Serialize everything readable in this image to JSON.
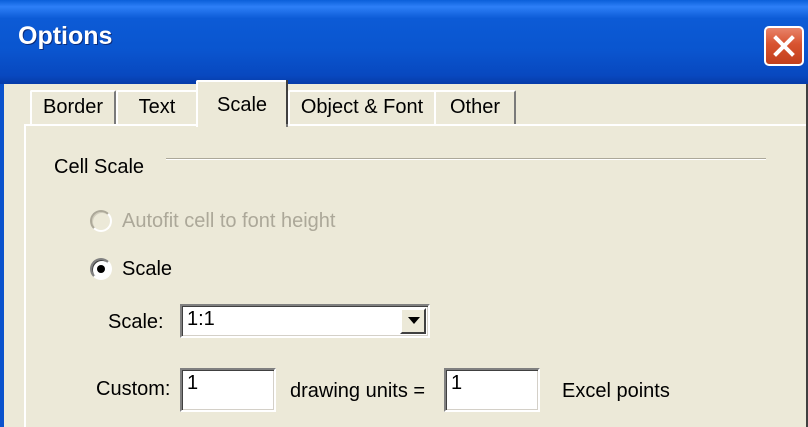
{
  "window": {
    "title": "Options"
  },
  "tabs": [
    {
      "label": "Border",
      "active": false
    },
    {
      "label": "Text",
      "active": false
    },
    {
      "label": "Scale",
      "active": true
    },
    {
      "label": "Object & Font",
      "active": false
    },
    {
      "label": "Other",
      "active": false
    }
  ],
  "cell_scale": {
    "group_label": "Cell Scale",
    "autofit_label": "Autofit cell to font height",
    "autofit_enabled": false,
    "autofit_selected": false,
    "scale_option_label": "Scale",
    "scale_option_selected": true,
    "scale_combo_label": "Scale:",
    "scale_value": "1:1",
    "custom_label": "Custom:",
    "custom_value_1": "1",
    "units_equals_label": "drawing units =",
    "custom_value_2": "1",
    "excel_points_label": "Excel points"
  },
  "icons": {
    "close": "close-icon",
    "dropdown": "chevron-down-icon"
  },
  "colors": {
    "titlebar": "#0a55cf",
    "close_button": "#d8532f",
    "dialog_background": "#ece9d8",
    "disabled_text": "#aca899"
  }
}
